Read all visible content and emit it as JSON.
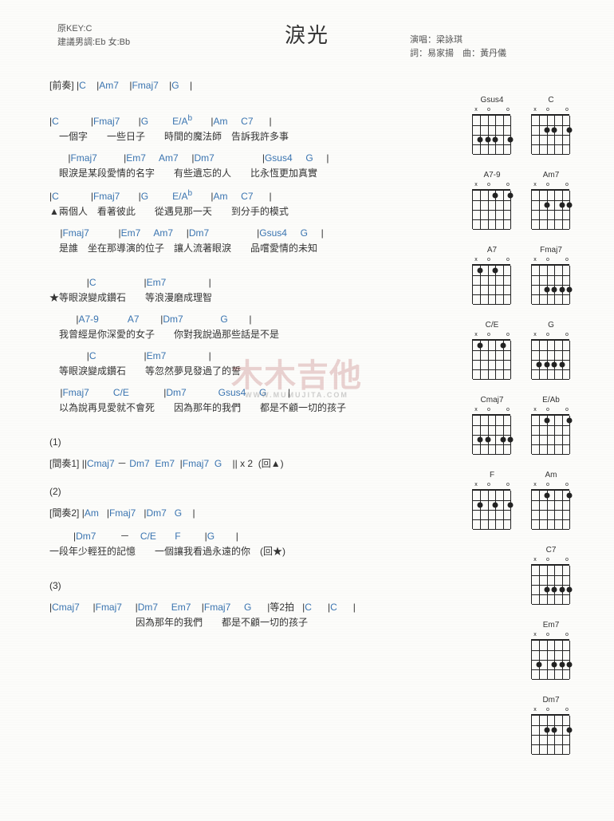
{
  "title": "淚光",
  "meta_left_line1": "原KEY:C",
  "meta_left_line2": "建議男調:Eb 女:Bb",
  "meta_right_line1": "演唱：梁詠琪",
  "meta_right_line2": "詞：易家揚　曲：黃丹儀",
  "intro": {
    "label": "[前奏]",
    "chords": [
      "C",
      "Am7",
      "Fmaj7",
      "G"
    ]
  },
  "verse1": {
    "line1_chords": [
      {
        "pos": 0,
        "type": "bar",
        "t": "|"
      },
      {
        "pos": 1,
        "type": "ch",
        "t": "C"
      },
      {
        "pos": 14,
        "type": "bar",
        "t": "|"
      },
      {
        "pos": 15,
        "type": "ch",
        "t": "Fmaj7"
      },
      {
        "pos": 27,
        "type": "bar",
        "t": "|"
      },
      {
        "pos": 28,
        "type": "ch",
        "t": "G"
      },
      {
        "pos": 38,
        "type": "ch",
        "t": "E/A"
      },
      {
        "pos": 41,
        "type": "sup",
        "t": "b"
      },
      {
        "pos": 49,
        "type": "bar",
        "t": "|"
      },
      {
        "pos": 50,
        "type": "ch",
        "t": "Am"
      },
      {
        "pos": 57,
        "type": "ch",
        "t": "C7"
      },
      {
        "pos": 65,
        "type": "bar",
        "t": "|"
      }
    ],
    "line1_lyrics": "　一個字　　一些日子　　時間的魔法師　告訴我許多事",
    "line2_chords": [
      {
        "pos": 7,
        "type": "bar",
        "t": "|"
      },
      {
        "pos": 8,
        "type": "ch",
        "t": "Fmaj7"
      },
      {
        "pos": 23,
        "type": "bar",
        "t": "|"
      },
      {
        "pos": 24,
        "type": "ch",
        "t": "Em7"
      },
      {
        "pos": 32,
        "type": "ch",
        "t": "Am7"
      },
      {
        "pos": 40,
        "type": "bar",
        "t": "|"
      },
      {
        "pos": 41,
        "type": "ch",
        "t": "Dm7"
      },
      {
        "pos": 62,
        "type": "bar",
        "t": "|"
      },
      {
        "pos": 63,
        "type": "ch",
        "t": "Gsus4"
      },
      {
        "pos": 73,
        "type": "ch",
        "t": "G"
      },
      {
        "pos": 79,
        "type": "bar",
        "t": "|"
      }
    ],
    "line2_lyrics": "　眼淚是某段愛情的名字　　有些遺忘的人　　比永恆更加真實",
    "line3_chords": [
      {
        "pos": 0,
        "type": "bar",
        "t": "|"
      },
      {
        "pos": 1,
        "type": "ch",
        "t": "C"
      },
      {
        "pos": 14,
        "type": "bar",
        "t": "|"
      },
      {
        "pos": 15,
        "type": "ch",
        "t": "Fmaj7"
      },
      {
        "pos": 27,
        "type": "bar",
        "t": "|"
      },
      {
        "pos": 28,
        "type": "ch",
        "t": "G"
      },
      {
        "pos": 38,
        "type": "ch",
        "t": "E/A"
      },
      {
        "pos": 41,
        "type": "sup",
        "t": "b"
      },
      {
        "pos": 49,
        "type": "bar",
        "t": "|"
      },
      {
        "pos": 50,
        "type": "ch",
        "t": "Am"
      },
      {
        "pos": 57,
        "type": "ch",
        "t": "C7"
      },
      {
        "pos": 65,
        "type": "bar",
        "t": "|"
      }
    ],
    "line3_lyrics": "▲兩個人　看著彼此　　從遇見那一天　　到分手的模式",
    "line4_chords": [
      {
        "pos": 4,
        "type": "bar",
        "t": "|"
      },
      {
        "pos": 5,
        "type": "ch",
        "t": "Fmaj7"
      },
      {
        "pos": 21,
        "type": "bar",
        "t": "|"
      },
      {
        "pos": 22,
        "type": "ch",
        "t": "Em7"
      },
      {
        "pos": 30,
        "type": "ch",
        "t": "Am7"
      },
      {
        "pos": 38,
        "type": "bar",
        "t": "|"
      },
      {
        "pos": 39,
        "type": "ch",
        "t": "Dm7"
      },
      {
        "pos": 60,
        "type": "bar",
        "t": "|"
      },
      {
        "pos": 61,
        "type": "ch",
        "t": "Gsus4"
      },
      {
        "pos": 71,
        "type": "ch",
        "t": "G"
      },
      {
        "pos": 77,
        "type": "bar",
        "t": "|"
      }
    ],
    "line4_lyrics": "　是誰　坐在那導演的位子　讓人流著眼淚　　品嚐愛情的未知"
  },
  "chorus": {
    "c1_chords": [
      {
        "pos": 14,
        "type": "bar",
        "t": "|"
      },
      {
        "pos": 15,
        "type": "ch",
        "t": "C"
      },
      {
        "pos": 34,
        "type": "bar",
        "t": "|"
      },
      {
        "pos": 35,
        "type": "ch",
        "t": "Em7"
      },
      {
        "pos": 54,
        "type": "bar",
        "t": "|"
      }
    ],
    "c1_lyrics": "★等眼淚變成鑽石　　等浪漫磨成理智",
    "c2_chords": [
      {
        "pos": 10,
        "type": "bar",
        "t": "|"
      },
      {
        "pos": 11,
        "type": "ch",
        "t": "A7-9"
      },
      {
        "pos": 26,
        "type": "ch",
        "t": "A7"
      },
      {
        "pos": 36,
        "type": "bar",
        "t": "|"
      },
      {
        "pos": 37,
        "type": "ch",
        "t": "Dm7"
      },
      {
        "pos": 54,
        "type": "ch",
        "t": "G"
      },
      {
        "pos": 63,
        "type": "bar",
        "t": "|"
      }
    ],
    "c2_lyrics": "　我曾經是你深愛的女子　　你對我說過那些話是不是",
    "c3_chords": [
      {
        "pos": 14,
        "type": "bar",
        "t": "|"
      },
      {
        "pos": 15,
        "type": "ch",
        "t": "C"
      },
      {
        "pos": 34,
        "type": "bar",
        "t": "|"
      },
      {
        "pos": 35,
        "type": "ch",
        "t": "Em7"
      },
      {
        "pos": 54,
        "type": "bar",
        "t": "|"
      }
    ],
    "c3_lyrics": "　等眼淚變成鑽石　　等忽然夢見發過了的誓",
    "c4_chords": [
      {
        "pos": 4,
        "type": "bar",
        "t": "|"
      },
      {
        "pos": 5,
        "type": "ch",
        "t": "Fmaj7"
      },
      {
        "pos": 19,
        "type": "ch",
        "t": "C/E"
      },
      {
        "pos": 35,
        "type": "bar",
        "t": "|"
      },
      {
        "pos": 36,
        "type": "ch",
        "t": "Dm7"
      },
      {
        "pos": 51,
        "type": "ch",
        "t": "Gsus4"
      },
      {
        "pos": 61,
        "type": "ch",
        "t": "G"
      },
      {
        "pos": 70,
        "type": "bar",
        "t": "|"
      }
    ],
    "c4_lyrics": "　以為說再見愛就不會死　　因為那年的我們　　都是不顧一切的孩子"
  },
  "bridge1": {
    "marker": "(1)",
    "label": "[間奏1]",
    "chords_text": " ||Cmaj7 － Dm7  Em7  |Fmaj7  G    || x 2  (回▲)"
  },
  "bridge2": {
    "marker": "(2)",
    "label": "[間奏2]",
    "chords_text": " |Am   |Fmaj7   |Dm7   G    |",
    "b2_chords": [
      {
        "pos": 9,
        "type": "bar",
        "t": "|"
      },
      {
        "pos": 10,
        "type": "ch",
        "t": "Dm7"
      },
      {
        "pos": 22,
        "type": "lbl",
        "t": "－"
      },
      {
        "pos": 27,
        "type": "ch",
        "t": "C/E"
      },
      {
        "pos": 37,
        "type": "ch",
        "t": "F"
      },
      {
        "pos": 47,
        "type": "bar",
        "t": "|"
      },
      {
        "pos": 48,
        "type": "ch",
        "t": "G"
      },
      {
        "pos": 57,
        "type": "bar",
        "t": "|"
      }
    ],
    "b2_lyrics": "一段年少輕狂的記憶　　一個讓我看過永遠的你　(回★)"
  },
  "outro": {
    "marker": "(3)",
    "o_chords": [
      {
        "pos": 0,
        "type": "bar",
        "t": "|"
      },
      {
        "pos": 1,
        "type": "ch",
        "t": "Cmaj7"
      },
      {
        "pos": 11,
        "type": "bar",
        "t": "|"
      },
      {
        "pos": 12,
        "type": "ch",
        "t": "Fmaj7"
      },
      {
        "pos": 22,
        "type": "bar",
        "t": "|"
      },
      {
        "pos": 23,
        "type": "ch",
        "t": "Dm7"
      },
      {
        "pos": 31,
        "type": "ch",
        "t": "Em7"
      },
      {
        "pos": 38,
        "type": "bar",
        "t": "|"
      },
      {
        "pos": 39,
        "type": "ch",
        "t": "Fmaj7"
      },
      {
        "pos": 49,
        "type": "ch",
        "t": "G"
      },
      {
        "pos": 56,
        "type": "bar",
        "t": "|"
      },
      {
        "pos": 57,
        "type": "lbl",
        "t": "等2拍"
      },
      {
        "pos": 63,
        "type": "bar",
        "t": "|"
      },
      {
        "pos": 64,
        "type": "ch",
        "t": "C"
      },
      {
        "pos": 71,
        "type": "bar",
        "t": "|"
      },
      {
        "pos": 72,
        "type": "ch",
        "t": "C"
      },
      {
        "pos": 79,
        "type": "bar",
        "t": "|"
      }
    ],
    "o_lyrics": "　　　　　　　　　因為那年的我們　　都是不顧一切的孩子"
  },
  "watermark_main": "木木吉他",
  "watermark_sub": "WWW.MUMUJITA.COM",
  "diagram_list": [
    [
      "Gsus4",
      "C"
    ],
    [
      "A7-9",
      "Am7"
    ],
    [
      "A7",
      "Fmaj7"
    ],
    [
      "C/E",
      "G"
    ],
    [
      "Cmaj7",
      "E/Ab"
    ],
    [
      "F",
      "Am"
    ],
    [
      "",
      "C7"
    ],
    [
      "",
      "Em7"
    ],
    [
      "",
      "Dm7"
    ]
  ]
}
